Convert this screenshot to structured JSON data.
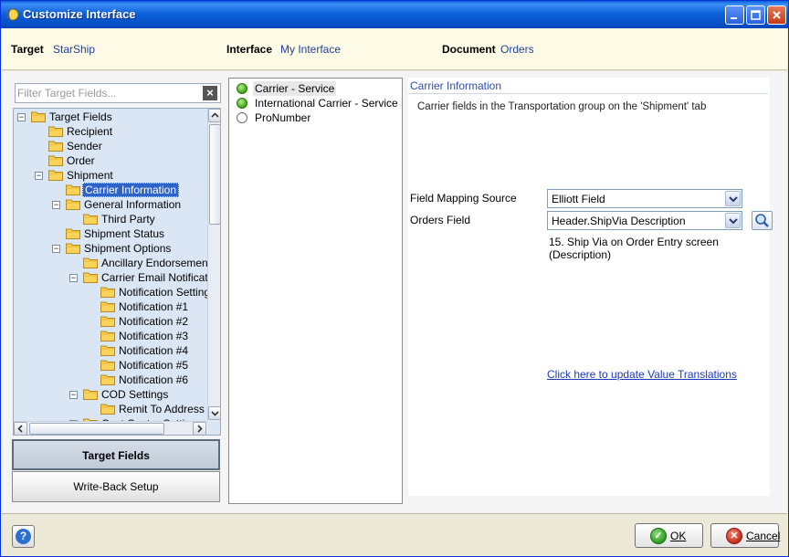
{
  "window": {
    "title": "Customize Interface"
  },
  "info": {
    "target_label": "Target",
    "target_value": "StarShip",
    "interface_label": "Interface",
    "interface_value": "My Interface",
    "document_label": "Document",
    "document_value": "Orders"
  },
  "left": {
    "filter_placeholder": "Filter Target Fields...",
    "tree": [
      {
        "label": "Target Fields",
        "level": 0,
        "expander": "-"
      },
      {
        "label": "Recipient",
        "level": 1,
        "expander": ""
      },
      {
        "label": "Sender",
        "level": 1,
        "expander": ""
      },
      {
        "label": "Order",
        "level": 1,
        "expander": ""
      },
      {
        "label": "Shipment",
        "level": 1,
        "expander": "-"
      },
      {
        "label": "Carrier Information",
        "level": 2,
        "expander": "",
        "selected": true
      },
      {
        "label": "General Information",
        "level": 2,
        "expander": "-"
      },
      {
        "label": "Third Party",
        "level": 3,
        "expander": ""
      },
      {
        "label": "Shipment Status",
        "level": 2,
        "expander": ""
      },
      {
        "label": "Shipment Options",
        "level": 2,
        "expander": "-"
      },
      {
        "label": "Ancillary Endorsement",
        "level": 3,
        "expander": ""
      },
      {
        "label": "Carrier Email Notification",
        "level": 3,
        "expander": "-"
      },
      {
        "label": "Notification Settings",
        "level": 4,
        "expander": ""
      },
      {
        "label": "Notification #1",
        "level": 4,
        "expander": ""
      },
      {
        "label": "Notification #2",
        "level": 4,
        "expander": ""
      },
      {
        "label": "Notification #3",
        "level": 4,
        "expander": ""
      },
      {
        "label": "Notification #4",
        "level": 4,
        "expander": ""
      },
      {
        "label": "Notification #5",
        "level": 4,
        "expander": ""
      },
      {
        "label": "Notification #6",
        "level": 4,
        "expander": ""
      },
      {
        "label": "COD Settings",
        "level": 3,
        "expander": "-"
      },
      {
        "label": "Remit To Address",
        "level": 4,
        "expander": ""
      },
      {
        "label": "Cost Center Settings",
        "level": 3,
        "expander": "-"
      }
    ],
    "nav_active": "Target Fields",
    "nav_inactive": "Write-Back Setup"
  },
  "middle": {
    "items": [
      {
        "label": "Carrier - Service",
        "mapped": true,
        "selected": true
      },
      {
        "label": "International Carrier - Service",
        "mapped": true,
        "selected": false
      },
      {
        "label": "ProNumber",
        "mapped": false,
        "selected": false
      }
    ]
  },
  "detail": {
    "heading": "Carrier Information",
    "description": "Carrier fields in the Transportation group on the 'Shipment' tab",
    "mapping_source_label": "Field Mapping Source",
    "mapping_source_value": "Elliott Field",
    "orders_field_label": "Orders Field",
    "orders_field_value": "Header.ShipVia Description",
    "hint": "15. Ship Via on Order Entry screen (Description)",
    "link": "Click here to update Value Translations"
  },
  "footer": {
    "ok_label": "OK",
    "cancel_label": "Cancel"
  },
  "colors": {
    "title_blue": "#0a5fd8",
    "selection": "#2d62c8",
    "link": "#1a3ab8",
    "mapped_green": "#3aa51a"
  }
}
